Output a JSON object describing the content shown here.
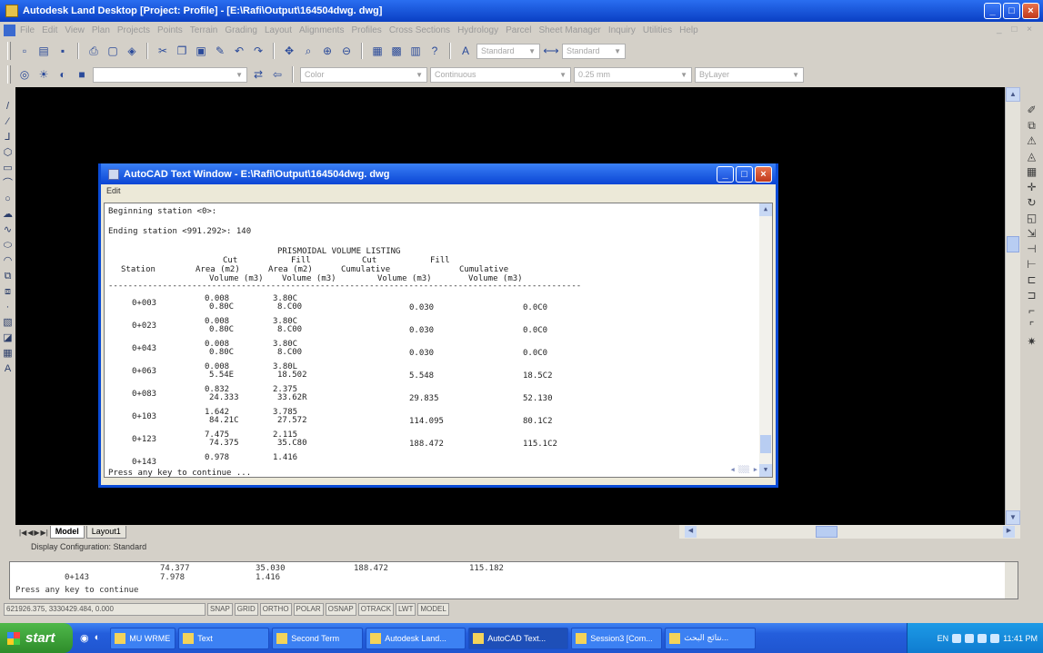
{
  "window": {
    "title": "Autodesk Land Desktop [Project: Profile] - [E:\\Rafi\\Output\\164504dwg. dwg]",
    "controls": [
      "_",
      "□",
      "×"
    ]
  },
  "menu": {
    "items": [
      "File",
      "Edit",
      "View",
      "Plan",
      "Projects",
      "Points",
      "Terrain",
      "Grading",
      "Layout",
      "Alignments",
      "Profiles",
      "Cross Sections",
      "Hydrology",
      "Parcel",
      "Sheet Manager",
      "Inquiry",
      "Utilities",
      "Help"
    ]
  },
  "toolbar2": {
    "layer_combo": "Standard",
    "style_combo": "Standard",
    "color_combo": "Color",
    "linetype_combo": "Continuous",
    "lineweight_combo": "0.25 mm",
    "plotstyle_combo": "ByLayer"
  },
  "layout_tabs": [
    "Model",
    "Layout1"
  ],
  "display_configuration": "Display Configuration:  Standard",
  "text_window": {
    "title": "AutoCAD Text Window - E:\\Rafi\\Output\\164504dwg. dwg",
    "menu_label": "Edit",
    "lines": [
      "Beginning station <0>:",
      "Ending station <991.292>: 140"
    ],
    "listing_title": "PRISMOIDAL VOLUME LISTING",
    "header_row1": [
      "",
      "Cut",
      "Fill",
      "Cut",
      "Fill"
    ],
    "header_row2": [
      "Station",
      "Area (m2)",
      "Area (m2)",
      "Cumulative",
      "Cumulative"
    ],
    "header_row3": [
      "",
      "Volume (m3)",
      "Volume (m3)",
      "Volume (m3)",
      "Volume (m3)"
    ],
    "rows": [
      {
        "station": "0+003",
        "cut_area": "0.008",
        "fill_area": "3.80C",
        "cut_vol": "0.80C",
        "fill_vol": "8.C00",
        "cut_cum": "0.030",
        "fill_cum": "0.0C0"
      },
      {
        "station": "0+023",
        "cut_area": "0.008",
        "fill_area": "3.80C",
        "cut_vol": "0.80C",
        "fill_vol": "8.C00",
        "cut_cum": "0.030",
        "fill_cum": "0.0C0"
      },
      {
        "station": "0+043",
        "cut_area": "0.008",
        "fill_area": "3.80C",
        "cut_vol": "0.80C",
        "fill_vol": "8.C00",
        "cut_cum": "0.030",
        "fill_cum": "0.0C0"
      },
      {
        "station": "0+063",
        "cut_area": "0.008",
        "fill_area": "3.80L",
        "cut_vol": "5.54E",
        "fill_vol": "18.502",
        "cut_cum": "5.548",
        "fill_cum": "18.5C2"
      },
      {
        "station": "0+083",
        "cut_area": "0.832",
        "fill_area": "2.375",
        "cut_vol": "24.333",
        "fill_vol": "33.62R",
        "cut_cum": "29.835",
        "fill_cum": "52.130"
      },
      {
        "station": "0+103",
        "cut_area": "1.642",
        "fill_area": "3.785",
        "cut_vol": "84.21C",
        "fill_vol": "27.572",
        "cut_cum": "114.095",
        "fill_cum": "80.1C2"
      },
      {
        "station": "0+123",
        "cut_area": "7.475",
        "fill_area": "2.115",
        "cut_vol": "74.375",
        "fill_vol": "35.C80",
        "cut_cum": "188.472",
        "fill_cum": "115.1C2"
      },
      {
        "station": "0+143",
        "cut_area": "0.978",
        "fill_area": "1.416",
        "cut_vol": "",
        "fill_vol": "",
        "cut_cum": "",
        "fill_cum": ""
      }
    ],
    "footer": "Press any key to continue ..."
  },
  "command_line": {
    "line1": [
      "74.377",
      "35.030",
      "188.472",
      "115.182"
    ],
    "line2": [
      "0+143",
      "7.978",
      "1.416"
    ],
    "line3": "Press any key to continue"
  },
  "status": {
    "coords": "621926.375, 3330429.484, 0.000",
    "buttons": [
      "SNAP",
      "GRID",
      "ORTHO",
      "POLAR",
      "OSNAP",
      "OTRACK",
      "LWT",
      "MODEL"
    ]
  },
  "taskbar": {
    "start_label": "start",
    "tasks": [
      {
        "label": "MU WRME"
      },
      {
        "label": "Text"
      },
      {
        "label": "Second Term"
      },
      {
        "label": "Autodesk Land..."
      },
      {
        "label": "AutoCAD Text..."
      },
      {
        "label": "Session3 [Com..."
      },
      {
        "label": "نتائج البحث..."
      }
    ],
    "clock": "11:41 PM",
    "lang": "EN"
  }
}
